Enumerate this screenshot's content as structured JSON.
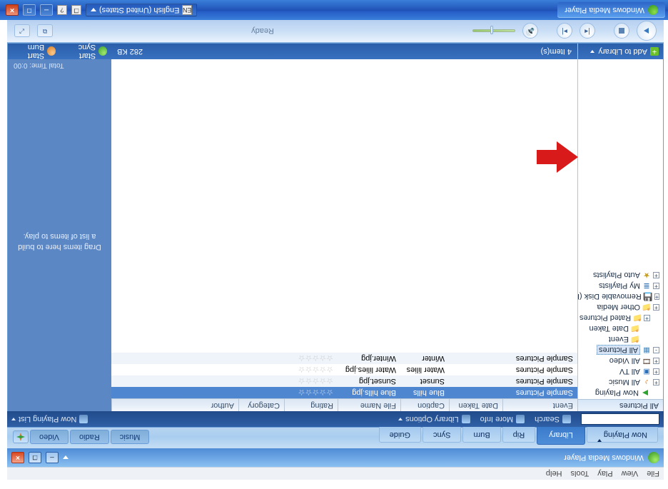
{
  "taskbar": {
    "app_button": "Windows Media Player",
    "lang_code": "EN",
    "lang_label": "English (United States)"
  },
  "window": {
    "menu": [
      "File",
      "View",
      "Play",
      "Tools",
      "Help"
    ],
    "title": "Windows Media Player",
    "minimize_glyph": "–",
    "close_glyph": "×"
  },
  "tabs": {
    "left": [
      "Now Playing",
      "Library",
      "Rip",
      "Burn",
      "Sync",
      "Guide"
    ],
    "active_index": 1,
    "right": [
      "Music",
      "Radio",
      "Video"
    ]
  },
  "toolbar": {
    "search_label": "Search",
    "search_value": "",
    "more_info": "More Info",
    "library_options": "Library Options",
    "now_playing_list": "Now Playing List"
  },
  "sidebar": {
    "title": "All Pictures",
    "add_button": "Add to Library",
    "nodes": [
      {
        "ind": 0,
        "exp": "",
        "icon": "play",
        "label": "Now Playing"
      },
      {
        "ind": 0,
        "exp": "+",
        "icon": "note",
        "label": "All Music"
      },
      {
        "ind": 0,
        "exp": "+",
        "icon": "tv",
        "label": "All TV"
      },
      {
        "ind": 0,
        "exp": "+",
        "icon": "film",
        "label": "All Video"
      },
      {
        "ind": 0,
        "exp": "-",
        "icon": "pic",
        "label": "All Pictures",
        "hl": true
      },
      {
        "ind": 1,
        "exp": "",
        "icon": "folder",
        "label": "Event"
      },
      {
        "ind": 1,
        "exp": "",
        "icon": "folder",
        "label": "Date Taken"
      },
      {
        "ind": 1,
        "exp": "+",
        "icon": "folder",
        "label": "Rated Pictures"
      },
      {
        "ind": 0,
        "exp": "+",
        "icon": "folder",
        "label": "Other Media"
      },
      {
        "ind": 0,
        "exp": "+",
        "icon": "disk",
        "label": "Removable Disk (F"
      },
      {
        "ind": 0,
        "exp": "+",
        "icon": "pl",
        "label": "My Playlists"
      },
      {
        "ind": 0,
        "exp": "+",
        "icon": "starf",
        "label": "Auto Playlists"
      }
    ]
  },
  "list": {
    "columns": [
      "Event",
      "Date Taken",
      "Caption",
      "File Name",
      "Rating",
      "Category",
      "Author"
    ],
    "rows": [
      {
        "event": "Sample Pictures",
        "caption": "Blue hills",
        "file": "Blue hills.jpg",
        "rating": "☆☆☆☆☆",
        "sel": true
      },
      {
        "event": "Sample Pictures",
        "caption": "Sunset",
        "file": "Sunset.jpg",
        "rating": "☆☆☆☆☆"
      },
      {
        "event": "Sample Pictures",
        "caption": "Water lilies",
        "file": "Water lilies.jpg",
        "rating": "☆☆☆☆☆"
      },
      {
        "event": "Sample Pictures",
        "caption": "Winter",
        "file": "Winter.jpg",
        "rating": "☆☆☆☆☆"
      }
    ],
    "count_label": "4 Item(s)",
    "size_label": "282 KB"
  },
  "rightpanel": {
    "hint": "Drag items here to build a list of items to play.",
    "total": "Total Time: 0:00",
    "start_sync": "Start Sync",
    "start_burn": "Start Burn"
  },
  "playbar": {
    "status": "Ready"
  }
}
